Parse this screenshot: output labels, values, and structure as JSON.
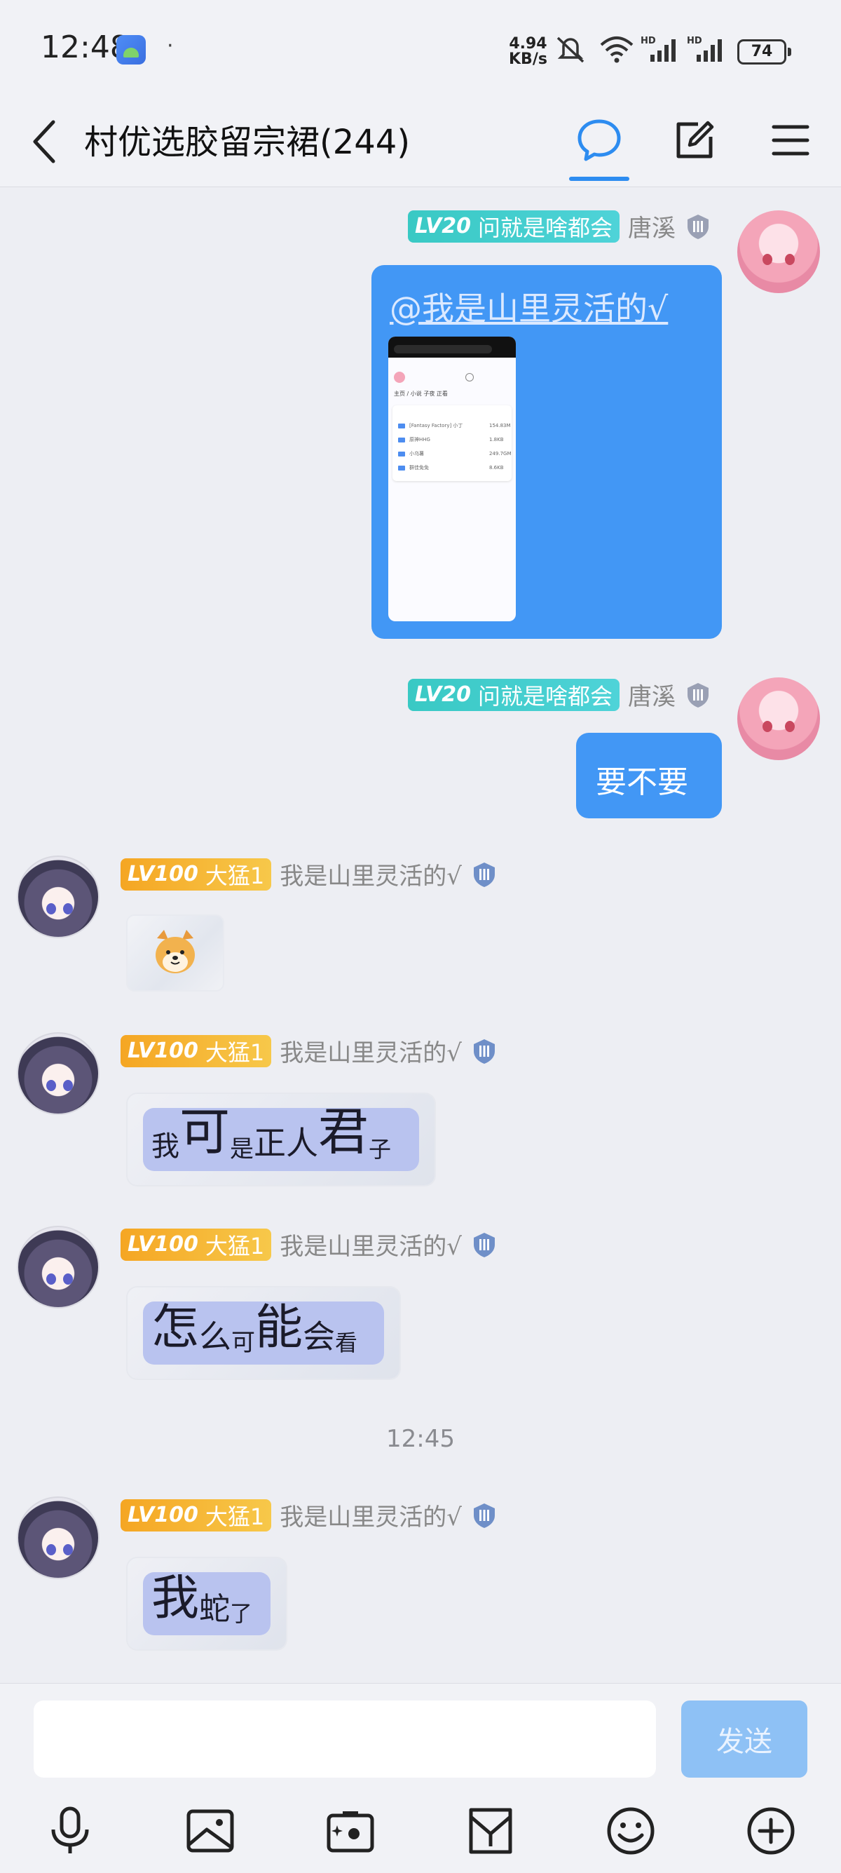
{
  "status_bar": {
    "time": "12:48",
    "dot": "·",
    "net_speed": "4.94",
    "net_unit": "KB/s",
    "battery": "74"
  },
  "header": {
    "title": "村优选胶留宗裙(244)"
  },
  "messages": [
    {
      "sender": "唐溪",
      "level_badge": "LV20",
      "title_badge": "问就是啥都会",
      "mention": "@我是山里灵活的√",
      "screenshot": {
        "tab1": "主页",
        "crumb": "/ 小说 子夜 正看",
        "rows": [
          {
            "name": "[Fantasy Factory] 小丁",
            "size": "154.83M"
          },
          {
            "name": "原神HHG",
            "size": "1.8KB"
          },
          {
            "name": "小乌薯",
            "size": "249.7GM"
          },
          {
            "name": "群佳免免",
            "size": "8.6KB"
          }
        ]
      }
    },
    {
      "sender": "唐溪",
      "level_badge": "LV20",
      "title_badge": "问就是啥都会",
      "text": "要不要"
    },
    {
      "sender": "我是山里灵活的√",
      "level_badge": "LV100",
      "title_badge": "大猛1",
      "emoji": "sticker"
    },
    {
      "sender": "我是山里灵活的√",
      "level_badge": "LV100",
      "title_badge": "大猛1",
      "styled_text": [
        "我",
        "可",
        "是",
        "正",
        "人",
        "君",
        "子"
      ]
    },
    {
      "sender": "我是山里灵活的√",
      "level_badge": "LV100",
      "title_badge": "大猛1",
      "styled_text": [
        "怎",
        "么",
        "可",
        "能",
        "会",
        "看"
      ]
    },
    {
      "sender": "我是山里灵活的√",
      "level_badge": "LV100",
      "title_badge": "大猛1",
      "styled_text": [
        "我",
        "蛇",
        "了"
      ]
    }
  ],
  "timestamp": "12:45",
  "input": {
    "value": "",
    "send_label": "发送"
  },
  "toolbar": {
    "icons": [
      "microphone-icon",
      "image-icon",
      "camera-icon",
      "file-icon",
      "emoji-icon",
      "plus-icon"
    ]
  },
  "colors": {
    "accent": "#2d8cf0",
    "bubble": "#4297f5",
    "badge_teal": "#39c9c4",
    "badge_gold": "#f5a623"
  }
}
